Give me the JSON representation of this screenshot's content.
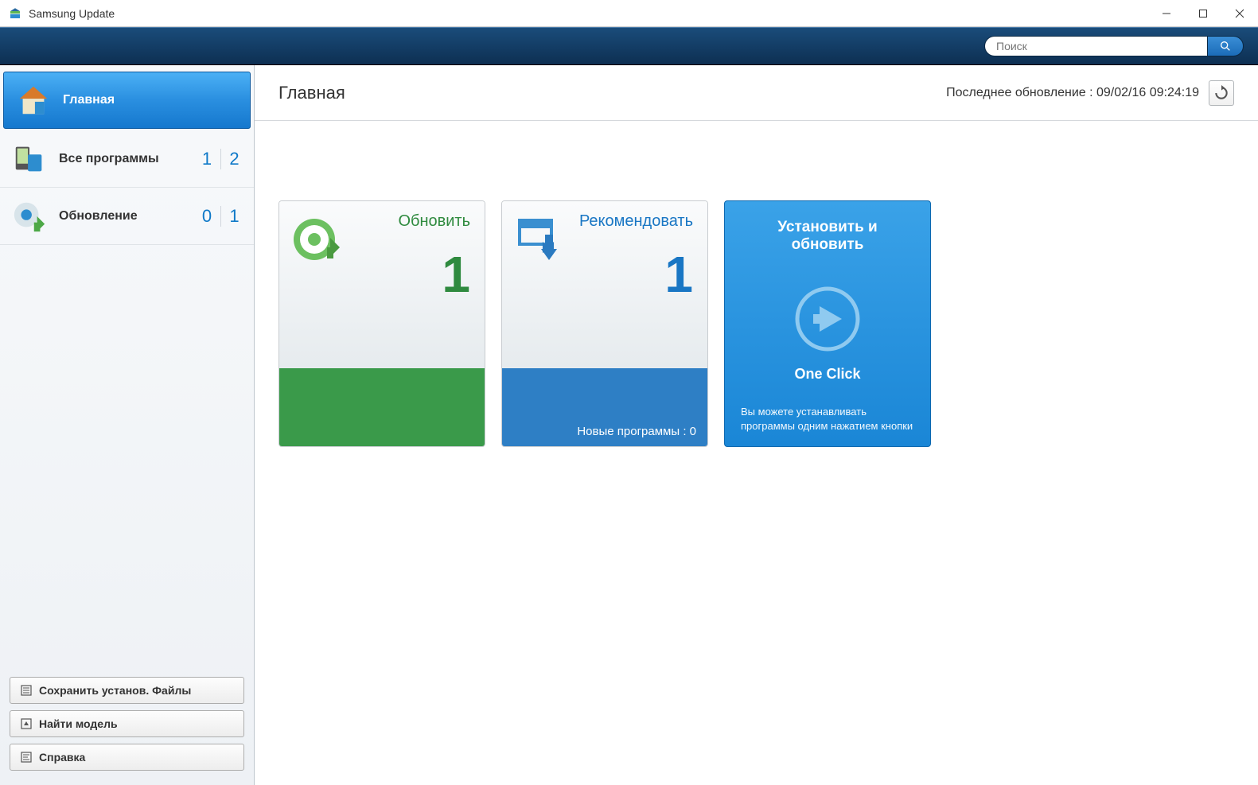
{
  "window": {
    "title": "Samsung Update"
  },
  "search": {
    "placeholder": "Поиск"
  },
  "sidebar": {
    "items": [
      {
        "label": "Главная"
      },
      {
        "label": "Все программы",
        "count1": "1",
        "count2": "2"
      },
      {
        "label": "Обновление",
        "count1": "0",
        "count2": "1"
      }
    ],
    "buttons": {
      "save_files": "Сохранить установ. Файлы",
      "find_model": "Найти модель",
      "help": "Справка"
    }
  },
  "main": {
    "title": "Главная",
    "last_update_label": "Последнее обновление : 09/02/16 09:24:19"
  },
  "cards": {
    "update": {
      "title": "Обновить",
      "count": "1"
    },
    "recommend": {
      "title": "Рекомендовать",
      "count": "1",
      "footer": "Новые программы : 0"
    },
    "install": {
      "title": "Установить и обновить",
      "one_click": "One Click",
      "desc": "Вы можете устанавливать программы одним нажатием кнопки"
    }
  }
}
